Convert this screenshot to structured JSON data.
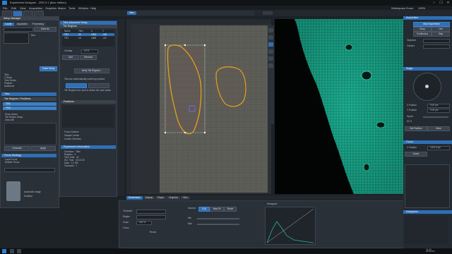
{
  "window": {
    "title": "Experiment Designer - ZEN 3.1 (blue edition)",
    "min": "–",
    "max": "☐",
    "close": "✕"
  },
  "workspace": {
    "label": "Workspace Zoom",
    "value": "100%"
  },
  "menu": [
    "File",
    "Edit",
    "View",
    "Acquisition",
    "Graphics",
    "Macro",
    "Tools",
    "Window",
    "Help"
  ],
  "left": {
    "tabs": [
      "Locate",
      "Acquisition",
      "Processing"
    ],
    "setup_header": "Setup Manager",
    "rows": [
      "Smart Setup",
      "Experiment Manager",
      "New",
      "Save As",
      "Tiles",
      "Z-Stack",
      "Time Series",
      "Position",
      "Autofocus",
      "Channels"
    ],
    "tiles_header": "Tiles",
    "sub_header": "Tile Regions / Positions",
    "options": [
      "Show viewer",
      "Tile Region Setup",
      "Auto size"
    ],
    "btn_generate": "Generate",
    "btn_apply": "Apply",
    "focus_header": "Focus Strategy",
    "focus_rows": [
      "Local Focus",
      "Definite Focus",
      "Use Z values"
    ],
    "ch_header": "Channels",
    "ch_rows": [
      "Track",
      "Ch1",
      "AF488"
    ],
    "auto_label": "Automatic Image",
    "auto_value": "Enabled"
  },
  "middle": {
    "header": "Tiles Advanced Setup",
    "sub": "Tile Regions",
    "table_cols": [
      "Name",
      "Tiles",
      "X",
      "Y"
    ],
    "table_rows": [
      [
        "TR1",
        "24",
        "1204",
        "-342"
      ],
      [
        "TR2",
        "18",
        "1688",
        "-210"
      ]
    ],
    "overlap_label": "Overlap",
    "overlap_value": "10 %",
    "btn_add": "Add",
    "btn_remove": "Remove",
    "btn_verify": "Verify Tile Regions...",
    "text1": "Tiles are automatically sorted by position",
    "text2": "Tile Regions are used to define the scan areas",
    "positions_header": "Positions",
    "focus_surface": "Focus Surface",
    "info_header": "Experiment Information",
    "info_rows": [
      [
        "Overview",
        "Tiles"
      ],
      [
        "Regions",
        "2"
      ],
      [
        "Tiles Total",
        "42"
      ],
      [
        "Est. Time",
        "00:12:30"
      ],
      [
        "Data",
        "1.2 GB"
      ],
      [
        "Channels",
        "1"
      ],
      [
        "Z-Slices",
        "1"
      ]
    ],
    "checks": [
      "Sample Carrier",
      "Create Overview",
      "Stitching"
    ]
  },
  "viewer": {
    "tabs": [
      "2D",
      "Tiles",
      "Split",
      "Gallery",
      "Ortho",
      "Info"
    ],
    "bottom_tabs": [
      "Dimensions",
      "Display",
      "Player",
      "Graphics",
      "Tiles"
    ],
    "labels": [
      "Channels",
      "Region",
      "Zoom",
      "Focus",
      "Reuse",
      "Gamma",
      "Min",
      "Max"
    ],
    "zoom_value": "100 %",
    "gamma_value": "1.00",
    "histogram_label": "Histogram",
    "best_fit": "Best Fit",
    "reset": "Reset"
  },
  "right": {
    "header": "Acquisition",
    "items": [
      "Start Experiment",
      "Snap",
      "Live",
      "Continuous",
      "Stop",
      "Objective",
      "Camera",
      "Focus",
      "Stage",
      "Illumination"
    ],
    "stage_header": "Stage",
    "x_label": "X Position",
    "x_value": "0.00 µm",
    "y_label": "Y Position",
    "y_value": "0.00 µm",
    "z_label": "Z Position",
    "z_value": "1204.5 µm",
    "btn_set": "Set Position",
    "btn_move": "Move",
    "btn_home": "Home",
    "speed_label": "Speed",
    "speed_value": "50 %",
    "focus_header": "Focus",
    "navigation": "Navigation"
  },
  "taskbar": {
    "time": "11:42",
    "date": "24.03.2021"
  },
  "colors": {
    "accent": "#2f6fb5",
    "fluor": "#1fb59c"
  }
}
